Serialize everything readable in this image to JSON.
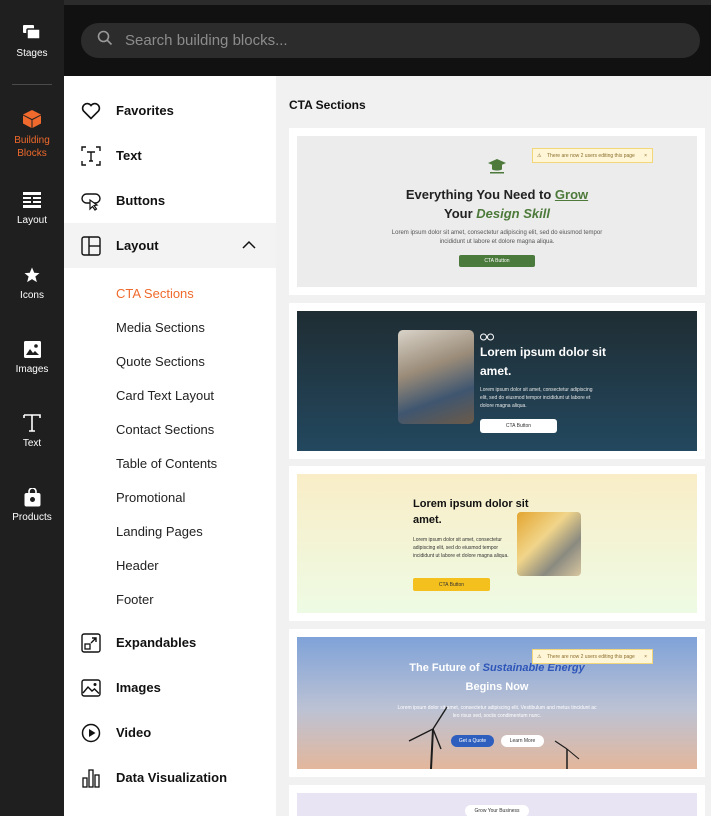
{
  "rail": {
    "items": [
      {
        "label": "Stages",
        "icon": "stages-icon"
      },
      {
        "label": "Building Blocks",
        "icon": "building-blocks-icon",
        "active": true
      },
      {
        "label": "Layout",
        "icon": "layout-icon"
      },
      {
        "label": "Icons",
        "icon": "star-icon"
      },
      {
        "label": "Images",
        "icon": "image-icon"
      },
      {
        "label": "Text",
        "icon": "text-icon"
      },
      {
        "label": "Products",
        "icon": "products-icon"
      }
    ]
  },
  "search": {
    "placeholder": "Search building blocks..."
  },
  "categories": {
    "favorites": "Favorites",
    "text": "Text",
    "buttons": "Buttons",
    "layout": "Layout",
    "expandables": "Expandables",
    "images": "Images",
    "video": "Video",
    "data_visualization": "Data Visualization"
  },
  "layout_subitems": [
    "CTA Sections",
    "Media Sections",
    "Quote Sections",
    "Card Text Layout",
    "Contact Sections",
    "Table of Contents",
    "Promotional",
    "Landing Pages",
    "Header",
    "Footer"
  ],
  "content": {
    "heading": "CTA Sections",
    "card1": {
      "heading_a": "Everything You Need to ",
      "heading_b": "Grow",
      "heading_c": "Your ",
      "heading_d": "Design Skill",
      "body": "Lorem ipsum dolor sit amet, consectetur adipiscing elit, sed do eiusmod tempor incididunt ut labore et dolore magna aliqua.",
      "button": "CTA Button",
      "note": "There are now 2 users editing this page"
    },
    "card2": {
      "heading": "Lorem ipsum dolor sit amet.",
      "body": "Lorem ipsum dolor sit amet, consectetur adipiscing elit, sed do eiusmod tempor incididunt ut labore et dolore magna aliqua.",
      "button": "CTA Button"
    },
    "card3": {
      "heading": "Lorem ipsum dolor sit amet.",
      "body": "Lorem ipsum dolor sit amet, consectetur adipiscing elit, sed do eiusmod tempor incididunt ut labore et dolore magna aliqua.",
      "button": "CTA Button"
    },
    "card4": {
      "heading_a": "The Future of ",
      "heading_b": "Sustainable Energy",
      "heading_c": "Begins Now",
      "body": "Lorem ipsum dolor sit amet, consectetur adipiscing elit. Vestibulum and metus tincidunt ac leo risus sed, sociis condimentum nunc.",
      "button_primary": "Get a Quote",
      "button_secondary": "Learn More",
      "note": "There are now 2 users editing this page"
    },
    "card5": {
      "pill": "Grow Your Business"
    }
  },
  "colors": {
    "accent": "#ef6a2c",
    "rail_bg": "#1f1f1f",
    "topbar_bg": "#111111"
  }
}
